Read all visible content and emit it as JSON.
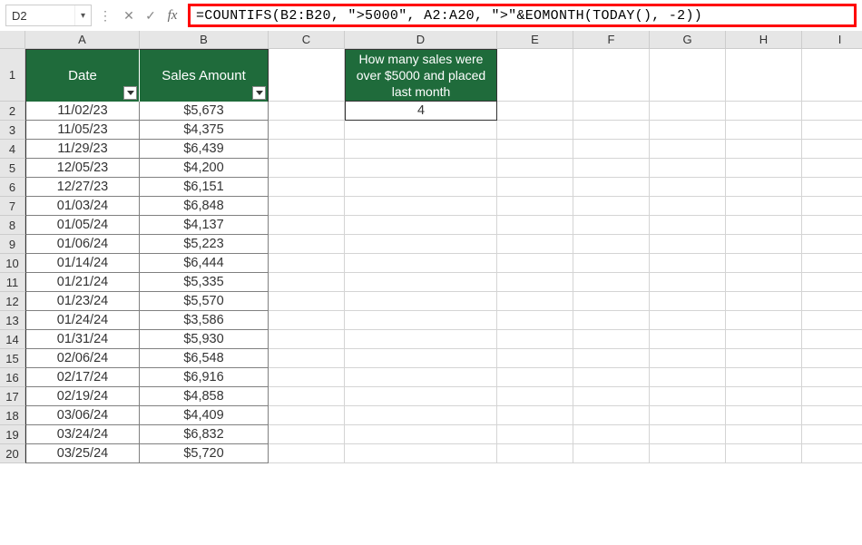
{
  "name_box": "D2",
  "formula": "=COUNTIFS(B2:B20, \">5000\", A2:A20, \">\"&EOMONTH(TODAY(), -2))",
  "columns": [
    "A",
    "B",
    "C",
    "D",
    "E",
    "F",
    "G",
    "H",
    "I"
  ],
  "header": {
    "date": "Date",
    "amount": "Sales Amount"
  },
  "question_header": "How many sales were over $5000 and placed last month",
  "result": "4",
  "rows": [
    {
      "n": 2,
      "date": "11/02/23",
      "amt": "$5,673"
    },
    {
      "n": 3,
      "date": "11/05/23",
      "amt": "$4,375"
    },
    {
      "n": 4,
      "date": "11/29/23",
      "amt": "$6,439"
    },
    {
      "n": 5,
      "date": "12/05/23",
      "amt": "$4,200"
    },
    {
      "n": 6,
      "date": "12/27/23",
      "amt": "$6,151"
    },
    {
      "n": 7,
      "date": "01/03/24",
      "amt": "$6,848"
    },
    {
      "n": 8,
      "date": "01/05/24",
      "amt": "$4,137"
    },
    {
      "n": 9,
      "date": "01/06/24",
      "amt": "$5,223"
    },
    {
      "n": 10,
      "date": "01/14/24",
      "amt": "$6,444"
    },
    {
      "n": 11,
      "date": "01/21/24",
      "amt": "$5,335"
    },
    {
      "n": 12,
      "date": "01/23/24",
      "amt": "$5,570"
    },
    {
      "n": 13,
      "date": "01/24/24",
      "amt": "$3,586"
    },
    {
      "n": 14,
      "date": "01/31/24",
      "amt": "$5,930"
    },
    {
      "n": 15,
      "date": "02/06/24",
      "amt": "$6,548"
    },
    {
      "n": 16,
      "date": "02/17/24",
      "amt": "$6,916"
    },
    {
      "n": 17,
      "date": "02/19/24",
      "amt": "$4,858"
    },
    {
      "n": 18,
      "date": "03/06/24",
      "amt": "$4,409"
    },
    {
      "n": 19,
      "date": "03/24/24",
      "amt": "$6,832"
    },
    {
      "n": 20,
      "date": "03/25/24",
      "amt": "$5,720"
    }
  ]
}
